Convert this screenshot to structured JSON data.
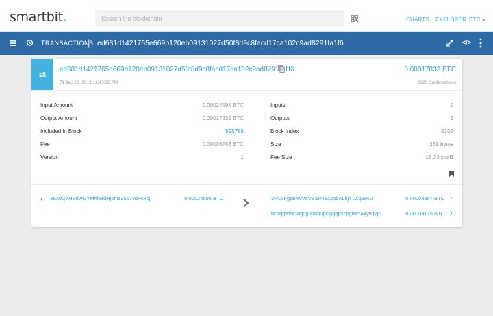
{
  "nav": {
    "logo_main": "smartbit",
    "logo_dot": ".",
    "search_placeholder": "Search the blockchain",
    "links": {
      "charts": "CHARTS",
      "explorer": "EXPLORER",
      "currency": "BTC"
    }
  },
  "bar": {
    "section": "TRANSACTIONS",
    "separator": "|",
    "hash": "ed681d1421765e669b120eb09131027d50f8d9c8facd17ca102c9ad8291fa1f6",
    "code_label": "</>"
  },
  "tx": {
    "hash": "ed681d1421765e669b120eb09131027d50f8d9c8facd17ca102c9ad8291fa1f6",
    "amount": "0.00017832 BTC",
    "time": "Sep 20, 2019 12:43:35 PM",
    "confirmations": "2223 Confirmations"
  },
  "details_left": [
    {
      "label": "Input Amount",
      "value": "0.00024595 BTC"
    },
    {
      "label": "Output Amount",
      "value": "0.00017832 BTC"
    },
    {
      "label": "Included in Block",
      "value": "595788"
    },
    {
      "label": "Fee",
      "value": "0.00006763 BTC"
    },
    {
      "label": "Version",
      "value": "1"
    }
  ],
  "details_right": [
    {
      "label": "Inputs",
      "value": "1"
    },
    {
      "label": "Outputs",
      "value": "2"
    },
    {
      "label": "Block Index",
      "value": "2109"
    },
    {
      "label": "Size",
      "value": "369 bytes"
    },
    {
      "label": "Fee Size",
      "value": "18.33 sat/B"
    }
  ],
  "inputs": [
    {
      "address": "3Ex9Q7HBdwt3YMhhBdHjohBS5o7vdPcxoj",
      "amount": "0.00024595 BTC"
    }
  ],
  "outputs": [
    {
      "address": "3PCvFgsBXvVdVBSP48z2pbALhjYLXq99sU",
      "amount": "0.00008657 BTC",
      "chevron": "›"
    },
    {
      "address": "bc1qqwf9ct8gdgrkmh0pclgqqpxcpgltw74xyvdjqc",
      "amount": "0.00009175 BTC",
      "chevron": "›"
    }
  ],
  "colors": {
    "accent": "#2fa6d8",
    "bar": "#2e6aa5",
    "tx_square": "#45b3e0"
  },
  "icons": [
    "qr-code-icon",
    "menu-icon",
    "history-icon",
    "expand-icon",
    "more-vertical-icon",
    "swap-icon",
    "copy-icon",
    "clock-icon",
    "bookmark-icon",
    "arrow-right-icon"
  ]
}
